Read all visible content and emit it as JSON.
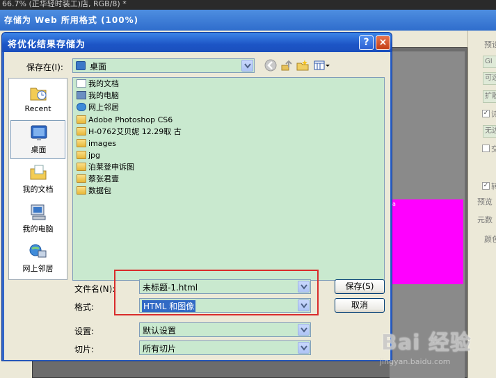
{
  "background": {
    "ps_title": "66.7% (正华轻时装工)店, RGB/8) *",
    "save_for_web_title": "存储为 Web 所用格式 (100%)",
    "magenta_label": "a",
    "right_panel": {
      "preset_label": "预设",
      "gif_value": "GI",
      "option1": "可选",
      "option2": "扩散",
      "check1": "诗",
      "option3": "无边",
      "check2": "交",
      "check3": "转",
      "preview_label": "预览",
      "metadata_label": "元数",
      "color_table_label": "颜色"
    }
  },
  "dialog": {
    "title": "将优化结果存储为",
    "help": "?",
    "close": "×",
    "save_in_label": "保存在(I):",
    "save_in_value": "桌面",
    "places": [
      "Recent",
      "桌面",
      "我的文档",
      "我的电脑",
      "网上邻居"
    ],
    "files": [
      {
        "name": "我的文档",
        "icon": "my-documents-icon"
      },
      {
        "name": "我的电脑",
        "icon": "my-computer-icon"
      },
      {
        "name": "网上邻居",
        "icon": "network-icon"
      },
      {
        "name": "Adobe Photoshop CS6",
        "icon": "folder-icon"
      },
      {
        "name": "H-0762艾贝妮  12.29取    古",
        "icon": "folder-icon"
      },
      {
        "name": "images",
        "icon": "folder-icon"
      },
      {
        "name": "jpg",
        "icon": "folder-icon"
      },
      {
        "name": "泊莱登申诉图",
        "icon": "folder-icon"
      },
      {
        "name": "蔡张君壹",
        "icon": "folder-icon"
      },
      {
        "name": "数据包",
        "icon": "folder-icon"
      }
    ],
    "filename_label": "文件名(N):",
    "filename_value": "未标题-1.html",
    "format_label": "格式:",
    "format_value": "HTML 和图像",
    "settings_label": "设置:",
    "settings_value": "默认设置",
    "slices_label": "切片:",
    "slices_value": "所有切片",
    "save_button": "保存(S)",
    "cancel_button": "取消"
  },
  "watermark": {
    "brand": "Bai 经验",
    "url": "jingyan.baidu.com"
  }
}
